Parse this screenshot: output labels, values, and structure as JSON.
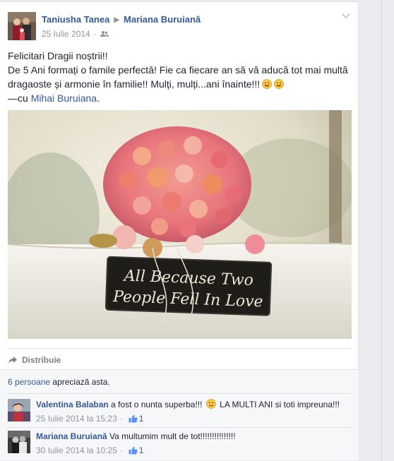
{
  "post": {
    "author": "Taniusha Tanea",
    "target": "Mariana Buruiană",
    "date": "25 Iulie 2014",
    "icons": {
      "audience": "friends-icon",
      "menu": "chevron-down-icon",
      "separator": "triangle-right-icon"
    },
    "text_line1": "Felicitari Dragii noștrii!!",
    "text_line2": "De 5 Ani formați o famile perfectă! Fie ca fiecare an să vă aducă tot mai multă dragaoste și armonie în familie!! Mulți, mulți...ani înainte!!!",
    "with_prefix": "—cu",
    "with_name": "Mihai Buruiana",
    "image_sign_line1": "All Because Two",
    "image_sign_line2": "People Fell In Love"
  },
  "actions": {
    "share_label": "Distribuie"
  },
  "likes": {
    "count_text": "6 persoane",
    "suffix": "apreciază asta."
  },
  "comments": [
    {
      "author": "Valentina Balaban",
      "text_before": "a fost o nunta superba!!!",
      "text_after": "LA MULTI ANI si toti impreuna!!!",
      "date": "25 Iulie 2014 la 15:23",
      "likes": "1"
    },
    {
      "author": "Mariana Buruiană",
      "text_before": "Va multumim mult de tot!!!!!!!!!!!!!!!",
      "text_after": "",
      "date": "30 Iulie 2014 la 10:25",
      "likes": "1"
    }
  ],
  "colors": {
    "link": "#365899",
    "meta": "#90949c",
    "background": "#e9ebee"
  }
}
